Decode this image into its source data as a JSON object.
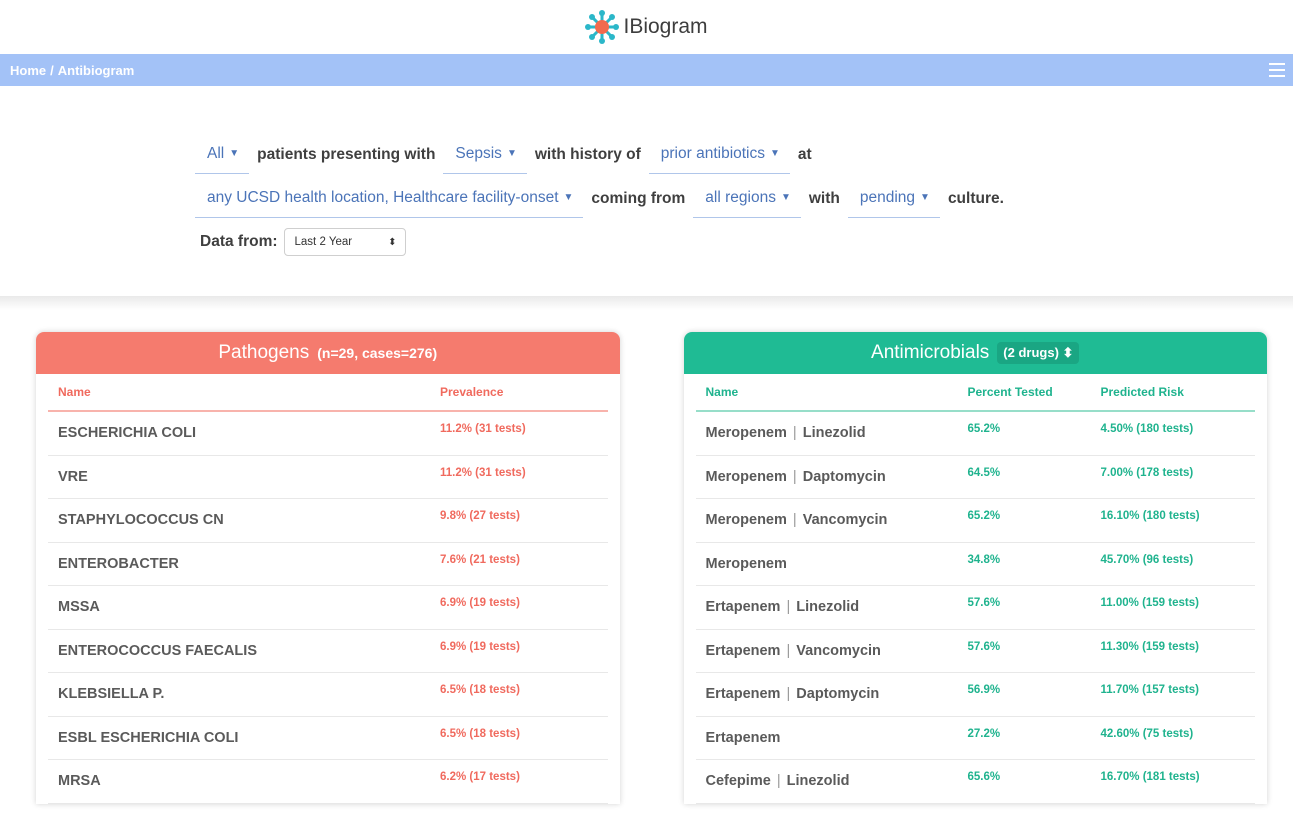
{
  "app": {
    "title": "IBiogram",
    "logo_icon": "virus-logo-icon"
  },
  "nav": {
    "home": "Home",
    "separator": "/",
    "current": "Antibiogram",
    "menu_icon": "hamburger-menu-icon"
  },
  "query": {
    "line1": {
      "patients_select": "All",
      "text1": "patients presenting with",
      "syndrome_select": "Sepsis",
      "text2": "with history of",
      "history_select": "prior antibiotics",
      "text3": "at"
    },
    "line2": {
      "location_select": "any UCSD health location, Healthcare facility-onset",
      "text1": "coming from",
      "region_select": "all regions",
      "text2": "with",
      "culture_select": "pending",
      "text3": "culture."
    },
    "data_from_label": "Data from:",
    "data_from_value": "Last 2 Year"
  },
  "pathogens": {
    "title": "Pathogens",
    "subtitle": "(n=29, cases=276)",
    "header_name": "Name",
    "header_prevalence": "Prevalence",
    "rows": [
      {
        "name": "ESCHERICHIA COLI",
        "prevalence": "11.2% (31 tests)"
      },
      {
        "name": "VRE",
        "prevalence": "11.2% (31 tests)"
      },
      {
        "name": "STAPHYLOCOCCUS CN",
        "prevalence": "9.8% (27 tests)"
      },
      {
        "name": "ENTEROBACTER",
        "prevalence": "7.6% (21 tests)"
      },
      {
        "name": "MSSA",
        "prevalence": "6.9% (19 tests)"
      },
      {
        "name": "ENTEROCOCCUS FAECALIS",
        "prevalence": "6.9% (19 tests)"
      },
      {
        "name": "KLEBSIELLA P.",
        "prevalence": "6.5% (18 tests)"
      },
      {
        "name": "ESBL ESCHERICHIA COLI",
        "prevalence": "6.5% (18 tests)"
      },
      {
        "name": "MRSA",
        "prevalence": "6.2% (17 tests)"
      }
    ]
  },
  "antimicrobials": {
    "title": "Antimicrobials",
    "drugs_select": "(2 drugs)",
    "header_name": "Name",
    "header_tested": "Percent Tested",
    "header_risk": "Predicted Risk",
    "rows": [
      {
        "drug1": "Meropenem",
        "drug2": "Linezolid",
        "tested": "65.2%",
        "risk": "4.50% (180 tests)"
      },
      {
        "drug1": "Meropenem",
        "drug2": "Daptomycin",
        "tested": "64.5%",
        "risk": "7.00% (178 tests)"
      },
      {
        "drug1": "Meropenem",
        "drug2": "Vancomycin",
        "tested": "65.2%",
        "risk": "16.10% (180 tests)"
      },
      {
        "drug1": "Meropenem",
        "drug2": "",
        "tested": "34.8%",
        "risk": "45.70% (96 tests)"
      },
      {
        "drug1": "Ertapenem",
        "drug2": "Linezolid",
        "tested": "57.6%",
        "risk": "11.00% (159 tests)"
      },
      {
        "drug1": "Ertapenem",
        "drug2": "Vancomycin",
        "tested": "57.6%",
        "risk": "11.30% (159 tests)"
      },
      {
        "drug1": "Ertapenem",
        "drug2": "Daptomycin",
        "tested": "56.9%",
        "risk": "11.70% (157 tests)"
      },
      {
        "drug1": "Ertapenem",
        "drug2": "",
        "tested": "27.2%",
        "risk": "42.60% (75 tests)"
      },
      {
        "drug1": "Cefepime",
        "drug2": "Linezolid",
        "tested": "65.6%",
        "risk": "16.70% (181 tests)"
      }
    ]
  },
  "colors": {
    "nav": "#a3c2f7",
    "pathogens": "#f57b6e",
    "antimicrobials": "#1fbb94",
    "select_text": "#4b74b8"
  }
}
